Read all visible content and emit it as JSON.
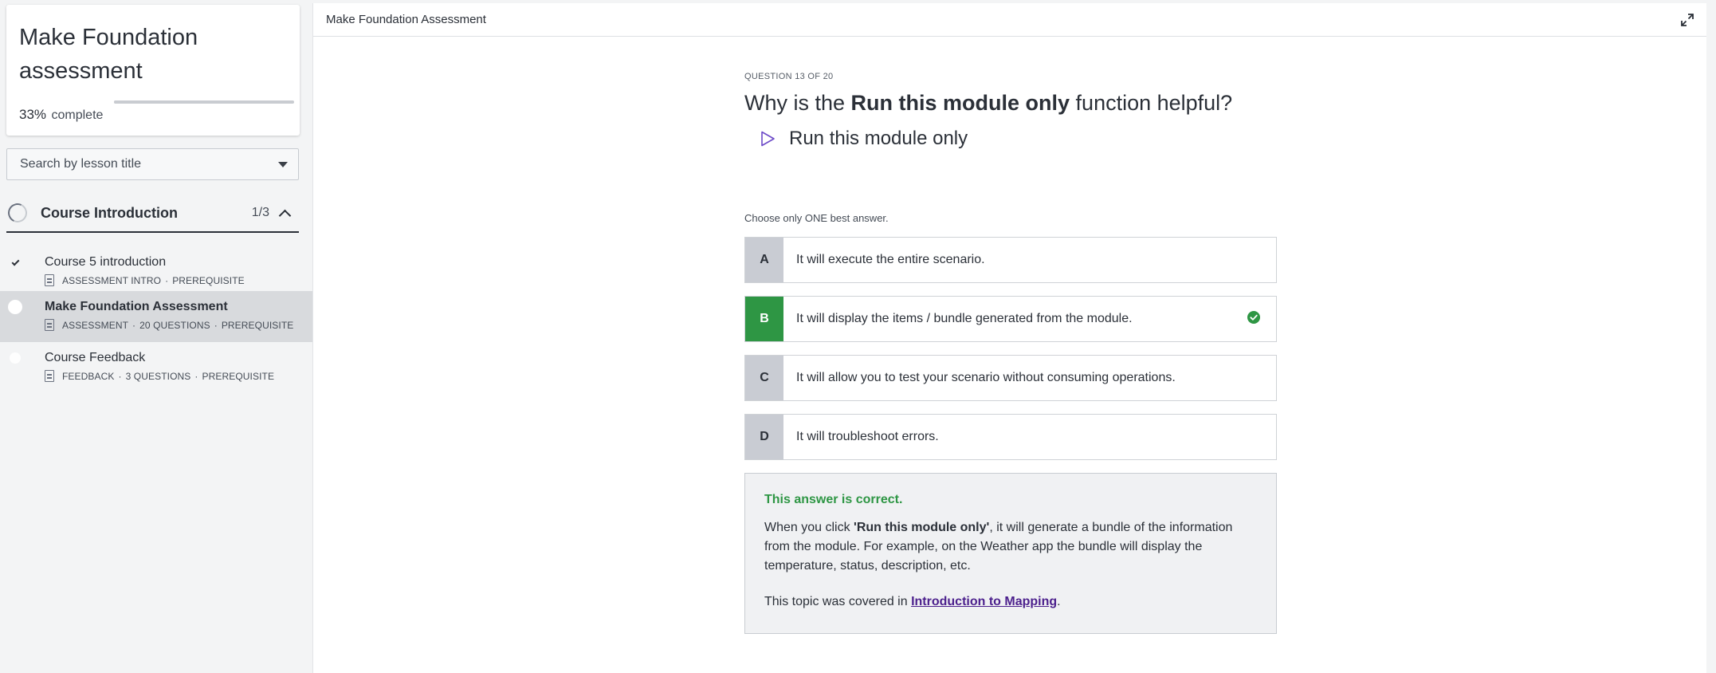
{
  "sidebar": {
    "course_title": "Make Foundation assessment",
    "progress_percent": "33%",
    "progress_word": "complete",
    "progress_value": 0.33,
    "search_placeholder": "Search by lesson title",
    "section": {
      "title": "Course Introduction",
      "count": "1/3"
    },
    "lessons": [
      {
        "title": "Course 5 introduction",
        "meta": [
          "ASSESSMENT INTRO",
          "PREREQUISITE"
        ],
        "status": "done"
      },
      {
        "title": "Make Foundation Assessment",
        "meta": [
          "ASSESSMENT",
          "20 QUESTIONS",
          "PREREQUISITE"
        ],
        "status": "current"
      },
      {
        "title": "Course Feedback",
        "meta": [
          "FEEDBACK",
          "3 QUESTIONS",
          "PREREQUISITE"
        ],
        "status": "pending"
      }
    ]
  },
  "header": {
    "title": "Make Foundation Assessment",
    "expand_icon": "expand-icon"
  },
  "question": {
    "number": "QUESTION 13 OF 20",
    "text_before": "Why is the ",
    "text_bold": "Run this module only",
    "text_after": " function helpful?",
    "image_label": "Run this module only",
    "image_icon": "play-icon",
    "instruction": "Choose only ONE best answer."
  },
  "answers": [
    {
      "letter": "A",
      "text": "It will execute the entire scenario."
    },
    {
      "letter": "B",
      "text": "It will display the items / bundle generated from the module.",
      "correct": true
    },
    {
      "letter": "C",
      "text": "It will allow you to test your scenario without consuming operations."
    },
    {
      "letter": "D",
      "text": "It will troubleshoot errors."
    }
  ],
  "feedback": {
    "heading": "This answer is correct.",
    "body_before": "When you click ",
    "body_bold": "'Run this module only'",
    "body_after": ", it will generate a bundle of the information from the module. For example, on the Weather app the bundle will display the temperature, status, description, etc.",
    "topic_before": "This topic was covered in ",
    "topic_link": "Introduction to Mapping",
    "topic_after": "."
  },
  "colors": {
    "correct_green": "#2e9644",
    "link_purple": "#4b1f8c",
    "answer_letter_bg": "#c9ccd3",
    "active_lesson_bg": "#d8dadd"
  }
}
